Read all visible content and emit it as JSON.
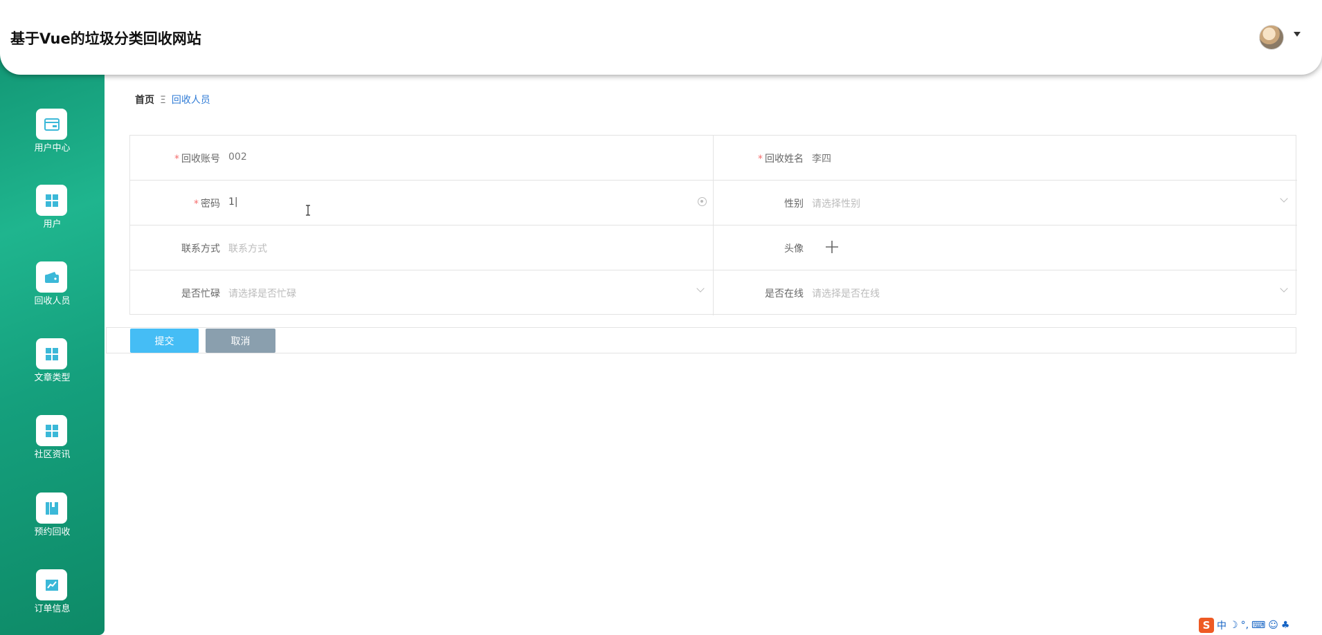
{
  "header": {
    "site_title": "基于Vue的垃圾分类回收网站"
  },
  "sidebar": {
    "items": [
      {
        "label": "用户中心",
        "icon": "card-icon"
      },
      {
        "label": "用户",
        "icon": "grid-icon"
      },
      {
        "label": "回收人员",
        "icon": "wallet-icon"
      },
      {
        "label": "文章类型",
        "icon": "grid-icon"
      },
      {
        "label": "社区资讯",
        "icon": "grid-icon"
      },
      {
        "label": "预约回收",
        "icon": "book-icon"
      },
      {
        "label": "订单信息",
        "icon": "chart-icon"
      }
    ]
  },
  "breadcrumb": {
    "home": "首页",
    "separator": "Ξ",
    "current": "回收人员"
  },
  "form": {
    "account": {
      "label": "回收账号",
      "value": "002",
      "required": "*"
    },
    "name": {
      "label": "回收姓名",
      "value": "李四",
      "required": "*"
    },
    "password": {
      "label": "密码",
      "value": "1|",
      "required": "*"
    },
    "gender": {
      "label": "性别",
      "placeholder": "请选择性别"
    },
    "contact": {
      "label": "联系方式",
      "placeholder": "联系方式"
    },
    "avatar": {
      "label": "头像"
    },
    "busy": {
      "label": "是否忙碌",
      "placeholder": "请选择是否忙碌"
    },
    "online": {
      "label": "是否在线",
      "placeholder": "请选择是否在线"
    }
  },
  "buttons": {
    "submit": "提交",
    "cancel": "取消"
  },
  "ime": {
    "logo": "S",
    "lang": "中",
    "punct": "°,"
  },
  "colors": {
    "sidebar": "#15a07d",
    "submit": "#45bdf5",
    "cancel": "#8a9fae",
    "link": "#2f7bd6",
    "required": "#f56c6c"
  }
}
